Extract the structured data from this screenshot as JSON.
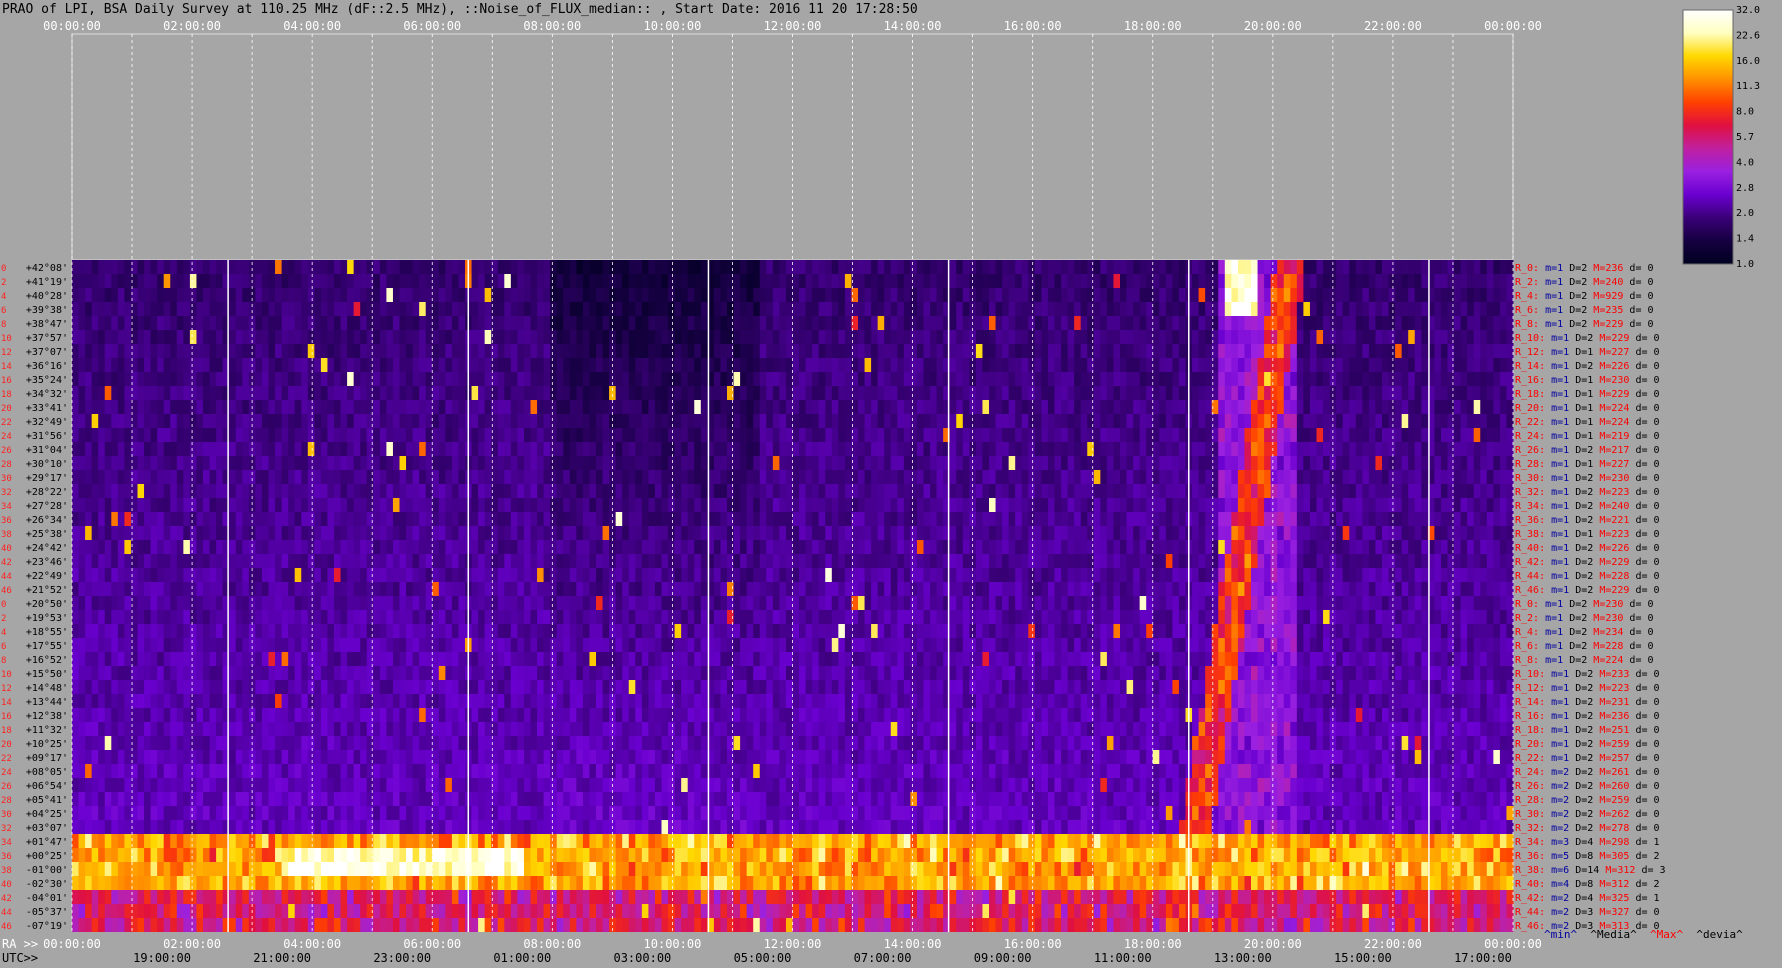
{
  "header": {
    "title": "PRAO of LPI, BSA Daily Survey at 110.25 MHz (dF::2.5 MHz), ::Noise_of_FLUX_median:: , Start Date: 2016 11 20 17:28:50"
  },
  "axes": {
    "top_ticks": [
      "00:00:00",
      "02:00:00",
      "04:00:00",
      "06:00:00",
      "08:00:00",
      "10:00:00",
      "12:00:00",
      "14:00:00",
      "16:00:00",
      "18:00:00",
      "20:00:00",
      "22:00:00",
      "00:00:00"
    ],
    "bottom_prefix": "RA >>",
    "bottom_ticks": [
      "00:00:00",
      "02:00:00",
      "04:00:00",
      "06:00:00",
      "08:00:00",
      "10:00:00",
      "12:00:00",
      "14:00:00",
      "16:00:00",
      "18:00:00",
      "20:00:00",
      "22:00:00",
      "00:00:00"
    ],
    "utc_prefix": "UTC>>",
    "utc_ticks": [
      "19:00:00",
      "21:00:00",
      "23:00:00",
      "01:00:00",
      "03:00:00",
      "05:00:00",
      "07:00:00",
      "09:00:00",
      "11:00:00",
      "13:00:00",
      "15:00:00",
      "17:00:00"
    ]
  },
  "declinations": [
    "+42°08'",
    "+41°19'",
    "+40°28'",
    "+39°38'",
    "+38°47'",
    "+37°57'",
    "+37°07'",
    "+36°16'",
    "+35°24'",
    "+34°32'",
    "+33°41'",
    "+32°49'",
    "+31°56'",
    "+31°04'",
    "+30°10'",
    "+29°17'",
    "+28°22'",
    "+27°28'",
    "+26°34'",
    "+25°38'",
    "+24°42'",
    "+23°46'",
    "+22°49'",
    "+21°52'",
    "+20°50'",
    "+19°53'",
    "+18°55'",
    "+17°55'",
    "+16°52'",
    "+15°50'",
    "+14°48'",
    "+13°44'",
    "+12°38'",
    "+11°32'",
    "+10°25'",
    "+09°17'",
    "+08°05'",
    "+06°54'",
    "+05°41'",
    "+04°25'",
    "+03°07'",
    "+01°47'",
    "+00°25'",
    "-01°00'",
    "-02°30'",
    "-04°01'",
    "-05°37'",
    "-07°19'"
  ],
  "beam_indices": [
    "0",
    "2",
    "4",
    "6",
    "8",
    "10",
    "12",
    "14",
    "16",
    "18",
    "20",
    "22",
    "24",
    "26",
    "28",
    "30",
    "32",
    "34",
    "36",
    "38",
    "40",
    "42",
    "44",
    "46",
    "0",
    "2",
    "4",
    "6",
    "8",
    "10",
    "12",
    "14",
    "16",
    "18",
    "20",
    "22",
    "24",
    "26",
    "28",
    "30",
    "32",
    "34",
    "36",
    "38",
    "40",
    "42",
    "44",
    "46"
  ],
  "beam_stats": [
    {
      "r": "R_0:",
      "m": "m=1",
      "d": "D=2",
      "M": "M=236",
      "dv": "d= 0"
    },
    {
      "r": "R_2:",
      "m": "m=1",
      "d": "D=2",
      "M": "M=240",
      "dv": "d= 0"
    },
    {
      "r": "R_4:",
      "m": "m=1",
      "d": "D=2",
      "M": "M=929",
      "dv": "d= 0"
    },
    {
      "r": "R_6:",
      "m": "m=1",
      "d": "D=2",
      "M": "M=235",
      "dv": "d= 0"
    },
    {
      "r": "R_8:",
      "m": "m=1",
      "d": "D=2",
      "M": "M=229",
      "dv": "d= 0"
    },
    {
      "r": "R_10:",
      "m": "m=1",
      "d": "D=2",
      "M": "M=229",
      "dv": "d= 0"
    },
    {
      "r": "R_12:",
      "m": "m=1",
      "d": "D=1",
      "M": "M=227",
      "dv": "d= 0"
    },
    {
      "r": "R_14:",
      "m": "m=1",
      "d": "D=2",
      "M": "M=226",
      "dv": "d= 0"
    },
    {
      "r": "R_16:",
      "m": "m=1",
      "d": "D=1",
      "M": "M=230",
      "dv": "d= 0"
    },
    {
      "r": "R_18:",
      "m": "m=1",
      "d": "D=1",
      "M": "M=229",
      "dv": "d= 0"
    },
    {
      "r": "R_20:",
      "m": "m=1",
      "d": "D=1",
      "M": "M=224",
      "dv": "d= 0"
    },
    {
      "r": "R_22:",
      "m": "m=1",
      "d": "D=1",
      "M": "M=224",
      "dv": "d= 0"
    },
    {
      "r": "R_24:",
      "m": "m=1",
      "d": "D=1",
      "M": "M=219",
      "dv": "d= 0"
    },
    {
      "r": "R_26:",
      "m": "m=1",
      "d": "D=2",
      "M": "M=217",
      "dv": "d= 0"
    },
    {
      "r": "R_28:",
      "m": "m=1",
      "d": "D=1",
      "M": "M=227",
      "dv": "d= 0"
    },
    {
      "r": "R_30:",
      "m": "m=1",
      "d": "D=2",
      "M": "M=230",
      "dv": "d= 0"
    },
    {
      "r": "R_32:",
      "m": "m=1",
      "d": "D=2",
      "M": "M=223",
      "dv": "d= 0"
    },
    {
      "r": "R_34:",
      "m": "m=1",
      "d": "D=2",
      "M": "M=240",
      "dv": "d= 0"
    },
    {
      "r": "R_36:",
      "m": "m=1",
      "d": "D=2",
      "M": "M=221",
      "dv": "d= 0"
    },
    {
      "r": "R_38:",
      "m": "m=1",
      "d": "D=1",
      "M": "M=223",
      "dv": "d= 0"
    },
    {
      "r": "R_40:",
      "m": "m=1",
      "d": "D=2",
      "M": "M=226",
      "dv": "d= 0"
    },
    {
      "r": "R_42:",
      "m": "m=1",
      "d": "D=2",
      "M": "M=229",
      "dv": "d= 0"
    },
    {
      "r": "R_44:",
      "m": "m=1",
      "d": "D=2",
      "M": "M=228",
      "dv": "d= 0"
    },
    {
      "r": "R_46:",
      "m": "m=1",
      "d": "D=2",
      "M": "M=229",
      "dv": "d= 0"
    },
    {
      "r": "R_0:",
      "m": "m=1",
      "d": "D=2",
      "M": "M=230",
      "dv": "d= 0"
    },
    {
      "r": "R_2:",
      "m": "m=1",
      "d": "D=2",
      "M": "M=230",
      "dv": "d= 0"
    },
    {
      "r": "R_4:",
      "m": "m=1",
      "d": "D=2",
      "M": "M=234",
      "dv": "d= 0"
    },
    {
      "r": "R_6:",
      "m": "m=1",
      "d": "D=2",
      "M": "M=228",
      "dv": "d= 0"
    },
    {
      "r": "R_8:",
      "m": "m=1",
      "d": "D=2",
      "M": "M=224",
      "dv": "d= 0"
    },
    {
      "r": "R_10:",
      "m": "m=1",
      "d": "D=2",
      "M": "M=233",
      "dv": "d= 0"
    },
    {
      "r": "R_12:",
      "m": "m=1",
      "d": "D=2",
      "M": "M=223",
      "dv": "d= 0"
    },
    {
      "r": "R_14:",
      "m": "m=1",
      "d": "D=2",
      "M": "M=231",
      "dv": "d= 0"
    },
    {
      "r": "R_16:",
      "m": "m=1",
      "d": "D=2",
      "M": "M=236",
      "dv": "d= 0"
    },
    {
      "r": "R_18:",
      "m": "m=1",
      "d": "D=2",
      "M": "M=251",
      "dv": "d= 0"
    },
    {
      "r": "R_20:",
      "m": "m=1",
      "d": "D=2",
      "M": "M=259",
      "dv": "d= 0"
    },
    {
      "r": "R_22:",
      "m": "m=1",
      "d": "D=2",
      "M": "M=257",
      "dv": "d= 0"
    },
    {
      "r": "R_24:",
      "m": "m=2",
      "d": "D=2",
      "M": "M=261",
      "dv": "d= 0"
    },
    {
      "r": "R_26:",
      "m": "m=2",
      "d": "D=2",
      "M": "M=260",
      "dv": "d= 0"
    },
    {
      "r": "R_28:",
      "m": "m=2",
      "d": "D=2",
      "M": "M=259",
      "dv": "d= 0"
    },
    {
      "r": "R_30:",
      "m": "m=2",
      "d": "D=2",
      "M": "M=262",
      "dv": "d= 0"
    },
    {
      "r": "R_32:",
      "m": "m=2",
      "d": "D=2",
      "M": "M=278",
      "dv": "d= 0"
    },
    {
      "r": "R_34:",
      "m": "m=3",
      "d": "D=4",
      "M": "M=298",
      "dv": "d= 1"
    },
    {
      "r": "R_36:",
      "m": "m=5",
      "d": "D=8",
      "M": "M=305",
      "dv": "d= 2"
    },
    {
      "r": "R_38:",
      "m": "m=6",
      "d": "D=14",
      "M": "M=312",
      "dv": "d= 3"
    },
    {
      "r": "R_40:",
      "m": "m=4",
      "d": "D=8",
      "M": "M=312",
      "dv": "d= 2"
    },
    {
      "r": "R_42:",
      "m": "m=2",
      "d": "D=4",
      "M": "M=325",
      "dv": "d= 1"
    },
    {
      "r": "R_44:",
      "m": "m=2",
      "d": "D=3",
      "M": "M=327",
      "dv": "d= 0"
    },
    {
      "r": "R_46:",
      "m": "m=2",
      "d": "D=3",
      "M": "M=313",
      "dv": "d= 0"
    }
  ],
  "colorbar": {
    "labels": [
      "32.0",
      "22.6",
      "16.0",
      "11.3",
      "8.0",
      "5.7",
      "4.0",
      "2.8",
      "2.0",
      "1.4",
      "1.0"
    ],
    "stops": [
      "#000020",
      "#150040",
      "#3a0078",
      "#6a00d0",
      "#9a20e0",
      "#c020a0",
      "#e01040",
      "#ff4000",
      "#ff9000",
      "#ffd800",
      "#ffffc0",
      "#ffffff"
    ]
  },
  "footer_legend": [
    {
      "text": "^min^",
      "color": "#0000a0"
    },
    {
      "text": "^Media^",
      "color": "#000000"
    },
    {
      "text": "^Max^",
      "color": "#ff0000"
    },
    {
      "text": "^devia^",
      "color": "#000000"
    }
  ],
  "stat_colors": {
    "r": "#ff0000",
    "m": "#0000a0",
    "d": "#000000",
    "M": "#ff0000",
    "dv": "#000000"
  },
  "chart_data": {
    "type": "heatmap",
    "title": "PRAO of LPI, BSA Daily Survey at 110.25 MHz (dF::2.5 MHz), ::Noise_of_FLUX_median:: , Start Date: 2016 11 20 17:28:50",
    "x_axis": "RA 00:00:00 - 00:00:00 (24 h), UTC 17:28:50 start",
    "y_axis": "Declination +42°08' to -07°19' (48 beams)",
    "value_range": [
      1.0,
      32.0
    ],
    "scale": "log",
    "features": [
      {
        "ra_h": 0.0,
        "ra_h_end": 24.0,
        "dec": "+00°25' to -02°30'",
        "level": 20.0
      },
      {
        "ra_h": 4.0,
        "ra_h_end": 7.0,
        "dec": "+00°25' to -02°30'",
        "level": 32.0
      },
      {
        "ra_h": 19.5,
        "dec": "+42°08' to +39°38'",
        "level": 32.0
      },
      {
        "ra_h": 18.5,
        "ra_h_end": 20.3,
        "dec": "-07°19' to +42°08'",
        "level": 8.0
      }
    ]
  }
}
